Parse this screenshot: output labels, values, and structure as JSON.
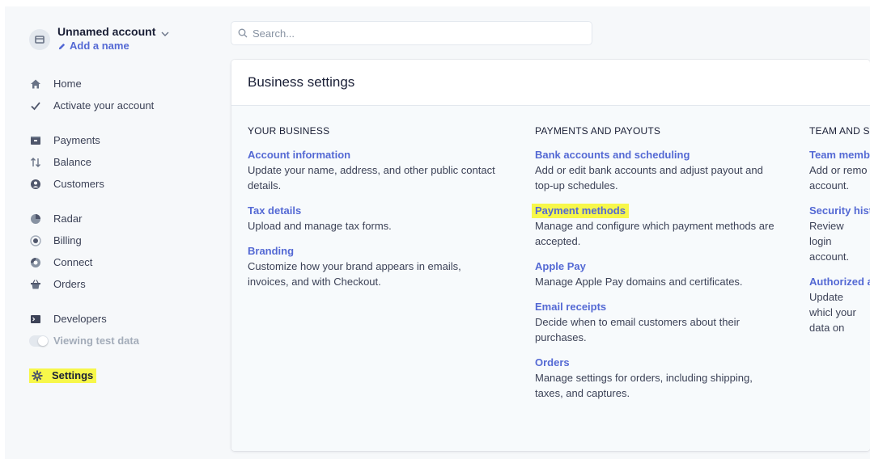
{
  "account": {
    "name": "Unnamed account",
    "add_name": "Add a name"
  },
  "search": {
    "placeholder": "Search..."
  },
  "sidebar": {
    "group1": [
      {
        "label": "Home",
        "icon": "home-icon"
      },
      {
        "label": "Activate your account",
        "icon": "checkmark-icon"
      }
    ],
    "group2": [
      {
        "label": "Payments",
        "icon": "wallet-icon"
      },
      {
        "label": "Balance",
        "icon": "arrows-icon"
      },
      {
        "label": "Customers",
        "icon": "user-icon"
      }
    ],
    "group3": [
      {
        "label": "Radar",
        "icon": "radar-icon"
      },
      {
        "label": "Billing",
        "icon": "billing-icon"
      },
      {
        "label": "Connect",
        "icon": "connect-icon"
      },
      {
        "label": "Orders",
        "icon": "orders-icon"
      }
    ],
    "group4": [
      {
        "label": "Developers",
        "icon": "terminal-icon"
      },
      {
        "label": "Viewing test data",
        "icon": "toggle-icon"
      }
    ],
    "settings": {
      "label": "Settings",
      "icon": "gear-icon"
    }
  },
  "main": {
    "title": "Business settings",
    "columns": [
      {
        "heading": "YOUR BUSINESS",
        "items": [
          {
            "title": "Account information",
            "desc": "Update your name, address, and other public contact details."
          },
          {
            "title": "Tax details",
            "desc": "Upload and manage tax forms."
          },
          {
            "title": "Branding",
            "desc": "Customize how your brand appears in emails, invoices, and with Checkout."
          }
        ]
      },
      {
        "heading": "PAYMENTS AND PAYOUTS",
        "items": [
          {
            "title": "Bank accounts and scheduling",
            "desc": "Add or edit bank accounts and adjust payout and top-up schedules."
          },
          {
            "title": "Payment methods",
            "desc": "Manage and configure which payment methods are accepted."
          },
          {
            "title": "Apple Pay",
            "desc": "Manage Apple Pay domains and certificates."
          },
          {
            "title": "Email receipts",
            "desc": "Decide when to email customers about their purchases."
          },
          {
            "title": "Orders",
            "desc": "Manage settings for orders, including shipping, taxes, and captures."
          }
        ]
      },
      {
        "heading": "TEAM AND SE",
        "items": [
          {
            "title": "Team memb",
            "desc": "Add or remo account."
          },
          {
            "title": "Security histo",
            "desc": "Review login account."
          },
          {
            "title": "Authorized a",
            "desc": "Update whicl your data on"
          }
        ]
      }
    ]
  },
  "colors": {
    "accent": "#5469d4",
    "highlight": "#f7f74a",
    "text": "#3c4257"
  }
}
